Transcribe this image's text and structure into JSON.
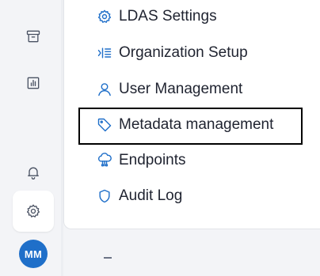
{
  "colors": {
    "accent": "#1f6fc9",
    "avatar_bg": "#1f6fc9",
    "rail_icon": "#4a5263",
    "text": "#1f2330",
    "highlight": "#000000"
  },
  "rail": {
    "items": [
      {
        "icon": "archive-icon"
      },
      {
        "icon": "bar-chart-icon"
      },
      {
        "icon": "bell-icon"
      },
      {
        "icon": "gear-icon",
        "active": true
      }
    ],
    "avatar": {
      "initials": "MM"
    }
  },
  "menu": {
    "items": [
      {
        "label": "LDAS Settings",
        "icon": "gear-icon"
      },
      {
        "label": "Organization Setup",
        "icon": "list-indent-icon"
      },
      {
        "label": "User Management",
        "icon": "user-icon"
      },
      {
        "label": "Metadata management",
        "icon": "tag-icon",
        "highlighted": true
      },
      {
        "label": "Endpoints",
        "icon": "endpoints-icon"
      },
      {
        "label": "Audit Log",
        "icon": "shield-icon"
      }
    ]
  }
}
